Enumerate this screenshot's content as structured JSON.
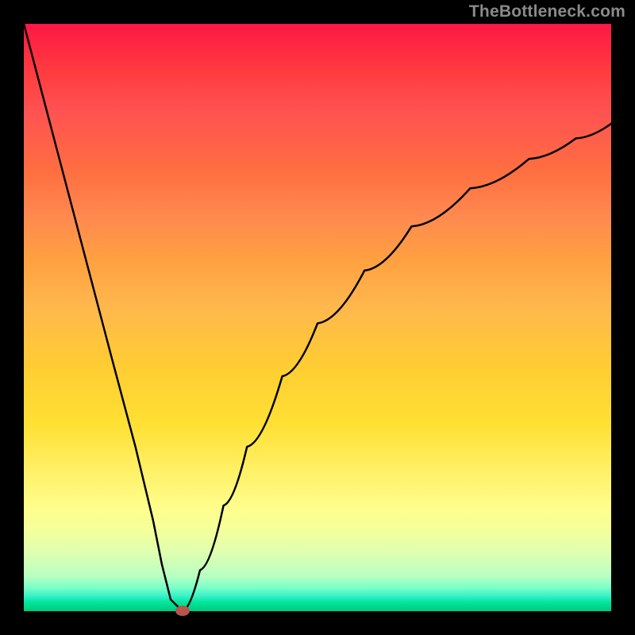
{
  "watermark": "TheBottleneck.com",
  "chart_data": {
    "type": "line",
    "title": "",
    "xlabel": "",
    "ylabel": "",
    "xlim": [
      0,
      100
    ],
    "ylim": [
      0,
      100
    ],
    "series": [
      {
        "name": "bottleneck-curve",
        "x": [
          0,
          5,
          10,
          15,
          19,
          22,
          23.5,
          25,
          27,
          30,
          34,
          38,
          44,
          50,
          58,
          66,
          76,
          86,
          94,
          100
        ],
        "values": [
          100,
          81,
          62,
          43,
          28,
          15.5,
          8,
          2,
          0,
          7,
          18,
          28,
          40,
          49,
          58,
          65.5,
          72,
          77,
          80.5,
          83
        ]
      }
    ],
    "min_point": {
      "x": 27,
      "y": 0
    },
    "grid": false,
    "legend": false
  }
}
